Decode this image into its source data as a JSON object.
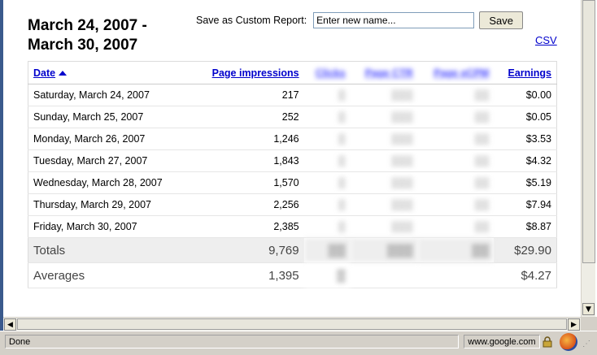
{
  "report": {
    "title": "March 24, 2007 - March 30, 2007",
    "save_label": "Save as Custom Report:",
    "save_placeholder": "Enter new name...",
    "save_button": "Save",
    "csv_link": "CSV"
  },
  "table": {
    "headers": [
      "Date",
      "Page impressions",
      "Clicks",
      "Page CTR",
      "Page eCPM",
      "Earnings"
    ],
    "blurred_columns": [
      2,
      3,
      4
    ],
    "rows": [
      {
        "date": "Saturday, March 24, 2007",
        "impressions": "217",
        "earnings": "$0.00"
      },
      {
        "date": "Sunday, March 25, 2007",
        "impressions": "252",
        "earnings": "$0.05"
      },
      {
        "date": "Monday, March 26, 2007",
        "impressions": "1,246",
        "earnings": "$3.53"
      },
      {
        "date": "Tuesday, March 27, 2007",
        "impressions": "1,843",
        "earnings": "$4.32"
      },
      {
        "date": "Wednesday, March 28, 2007",
        "impressions": "1,570",
        "earnings": "$5.19"
      },
      {
        "date": "Thursday, March 29, 2007",
        "impressions": "2,256",
        "earnings": "$7.94"
      },
      {
        "date": "Friday, March 30, 2007",
        "impressions": "2,385",
        "earnings": "$8.87"
      }
    ],
    "totals": {
      "label": "Totals",
      "impressions": "9,769",
      "earnings": "$29.90"
    },
    "averages": {
      "label": "Averages",
      "impressions": "1,395",
      "earnings": "$4.27"
    }
  },
  "statusbar": {
    "status": "Done",
    "host": "www.google.com"
  },
  "icons": {
    "sort": "sort-ascending-icon",
    "lock": "lock-icon",
    "browser": "firefox-icon"
  }
}
